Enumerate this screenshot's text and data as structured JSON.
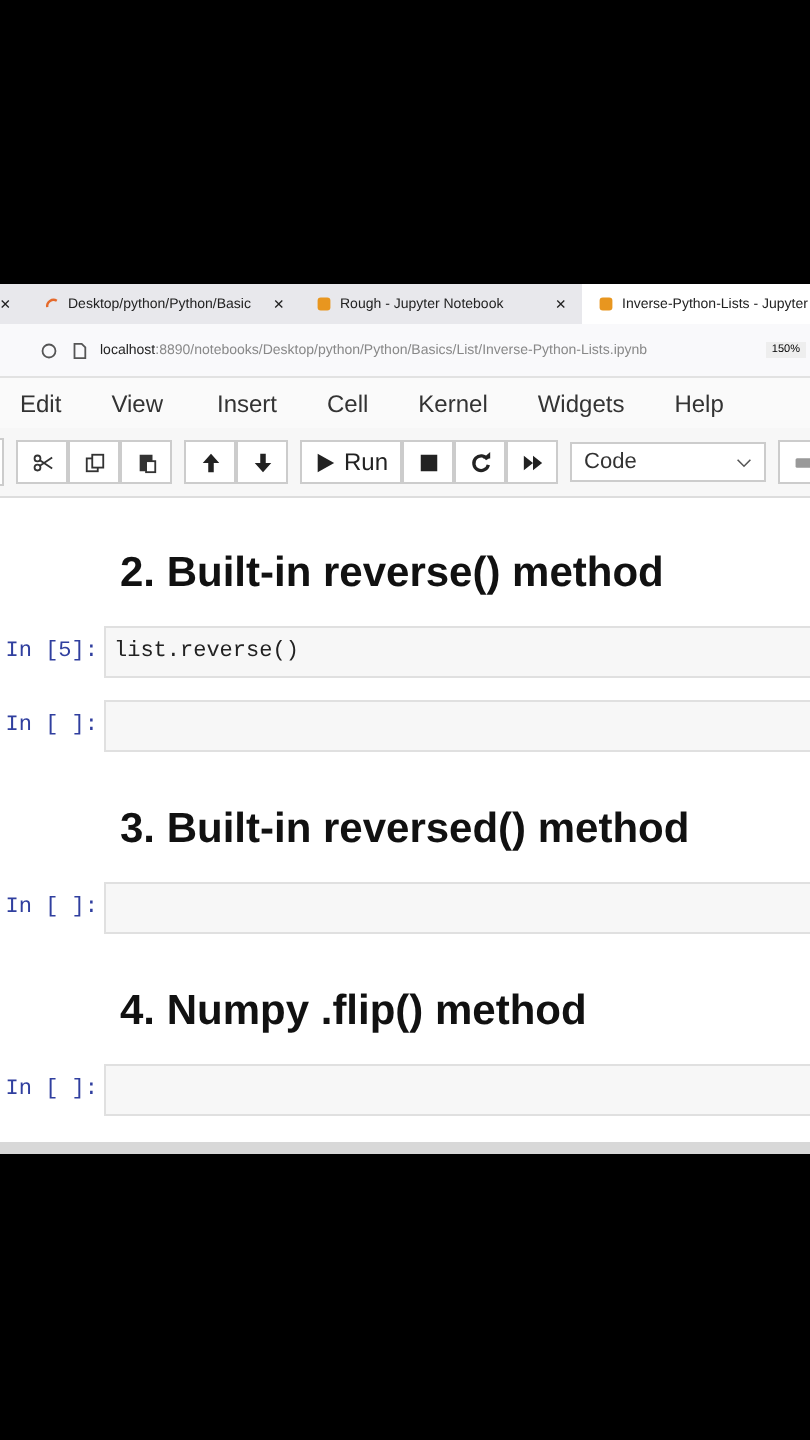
{
  "browser": {
    "tabs": [
      {
        "close": "×",
        "selected": false,
        "kind": "plain"
      },
      {
        "title": "Desktop/python/Python/Basic",
        "close": "×",
        "selected": false,
        "kind": "loading"
      },
      {
        "title": "Rough - Jupyter Notebook",
        "close": "×",
        "selected": false,
        "kind": "notebook"
      },
      {
        "title": "Inverse-Python-Lists - Jupyter",
        "selected": true,
        "kind": "notebook"
      }
    ],
    "address": {
      "host": "localhost",
      "path": ":8890/notebooks/Desktop/python/Python/Basics/List/Inverse-Python-Lists.ipynb",
      "zoom": "150%"
    }
  },
  "menu": [
    "Edit",
    "View",
    "Insert",
    "Cell",
    "Kernel",
    "Widgets",
    "Help"
  ],
  "toolbar": {
    "run": "Run",
    "cell_type": "Code"
  },
  "cells": [
    {
      "kind": "heading",
      "text": "2. Built-in reverse() method"
    },
    {
      "kind": "code",
      "prompt": "In [5]:",
      "code": "list.reverse()"
    },
    {
      "kind": "code",
      "prompt": "In [ ]:"
    },
    {
      "kind": "heading",
      "text": "3. Built-in reversed() method"
    },
    {
      "kind": "code",
      "prompt": "In [ ]:"
    },
    {
      "kind": "heading",
      "text": "4. Numpy .flip() method"
    },
    {
      "kind": "code",
      "prompt": "In [ ]:"
    }
  ]
}
